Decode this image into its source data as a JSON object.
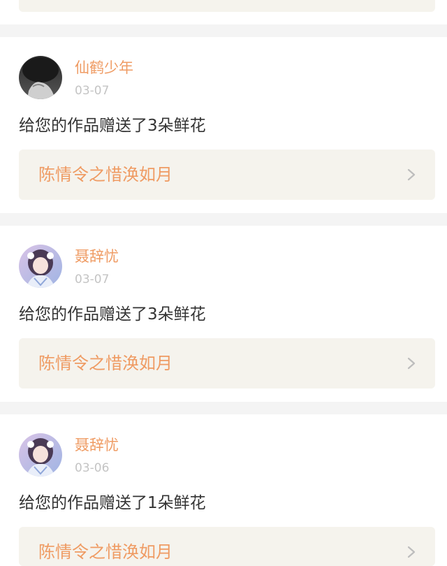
{
  "feed": [
    {
      "username": "仙鹤少年",
      "date": "03-07",
      "message": "给您的作品赠送了3朵鲜花",
      "work_title": "陈情令之惜涣如月",
      "avatar_icon": "dark-portrait-avatar"
    },
    {
      "username": "聂辞忧",
      "date": "03-07",
      "message": "给您的作品赠送了3朵鲜花",
      "work_title": "陈情令之惜涣如月",
      "avatar_icon": "anime-girl-avatar"
    },
    {
      "username": "聂辞忧",
      "date": "03-06",
      "message": "给您的作品赠送了1朵鲜花",
      "work_title": "陈情令之惜涣如月",
      "avatar_icon": "anime-girl-avatar"
    }
  ],
  "colors": {
    "accent": "#ef9b63",
    "link_bg": "#f5f3ed",
    "date": "#c4c4c4",
    "text": "#333333"
  }
}
